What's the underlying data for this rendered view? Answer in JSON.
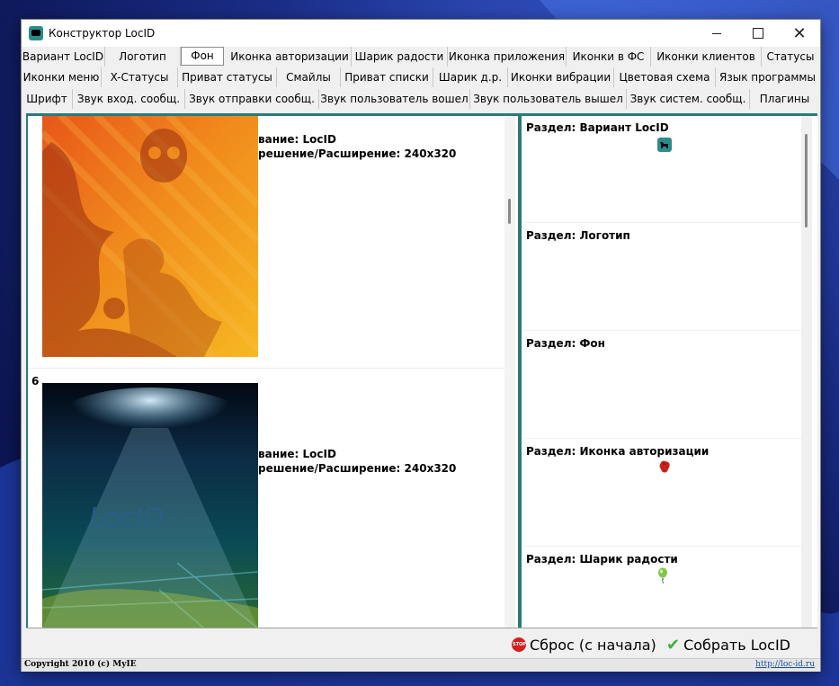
{
  "window": {
    "title": "Конструктор LocID"
  },
  "tabs": {
    "row1": [
      "Вариант LocID",
      "Логотип",
      "Фон",
      "Иконка авторизации",
      "Шарик радости",
      "Иконка приложения",
      "Иконки в ФС",
      "Иконки клиентов",
      "Статусы"
    ],
    "row2": [
      "Иконки меню",
      "X-Статусы",
      "Приват статусы",
      "Смайлы",
      "Приват списки",
      "Шарик д.р.",
      "Иконки вибрации",
      "Цветовая схема",
      "Язык программы"
    ],
    "row3": [
      "Шрифт",
      "Звук вход. сообщ.",
      "Звук отправки сообщ.",
      "Звук пользователь вошел",
      "Звук пользователь вышел",
      "Звук систем. сообщ.",
      "Плагины"
    ],
    "active": "Фон"
  },
  "backgrounds": [
    {
      "number": "",
      "name_line": "вание: LocID",
      "res_line": "решение/Расширение: 240x320",
      "image": "orange-skull-background"
    },
    {
      "number": "6",
      "name_line": "вание: LocID",
      "res_line": "решение/Расширение: 240x320",
      "image": "dark-sky-locid-background"
    }
  ],
  "image_caption": "LocID",
  "sections": [
    {
      "title": "Раздел: Вариант LocID",
      "icon": "locid-dog-icon"
    },
    {
      "title": "Раздел: Логотип",
      "icon": ""
    },
    {
      "title": "Раздел: Фон",
      "icon": ""
    },
    {
      "title": "Раздел: Иконка авторизации",
      "icon": "red-glove-icon"
    },
    {
      "title": "Раздел: Шарик радости",
      "icon": "green-balloon-icon"
    }
  ],
  "buttons": {
    "reset": "Сброс (с начала)",
    "build": "Собрать LocID"
  },
  "footer": {
    "copyright": "Copyright 2010 (c) MyIE",
    "site": "http://loc-id.ru"
  },
  "colors": {
    "accent": "#2a7a7a",
    "link": "#1a4fb0"
  }
}
